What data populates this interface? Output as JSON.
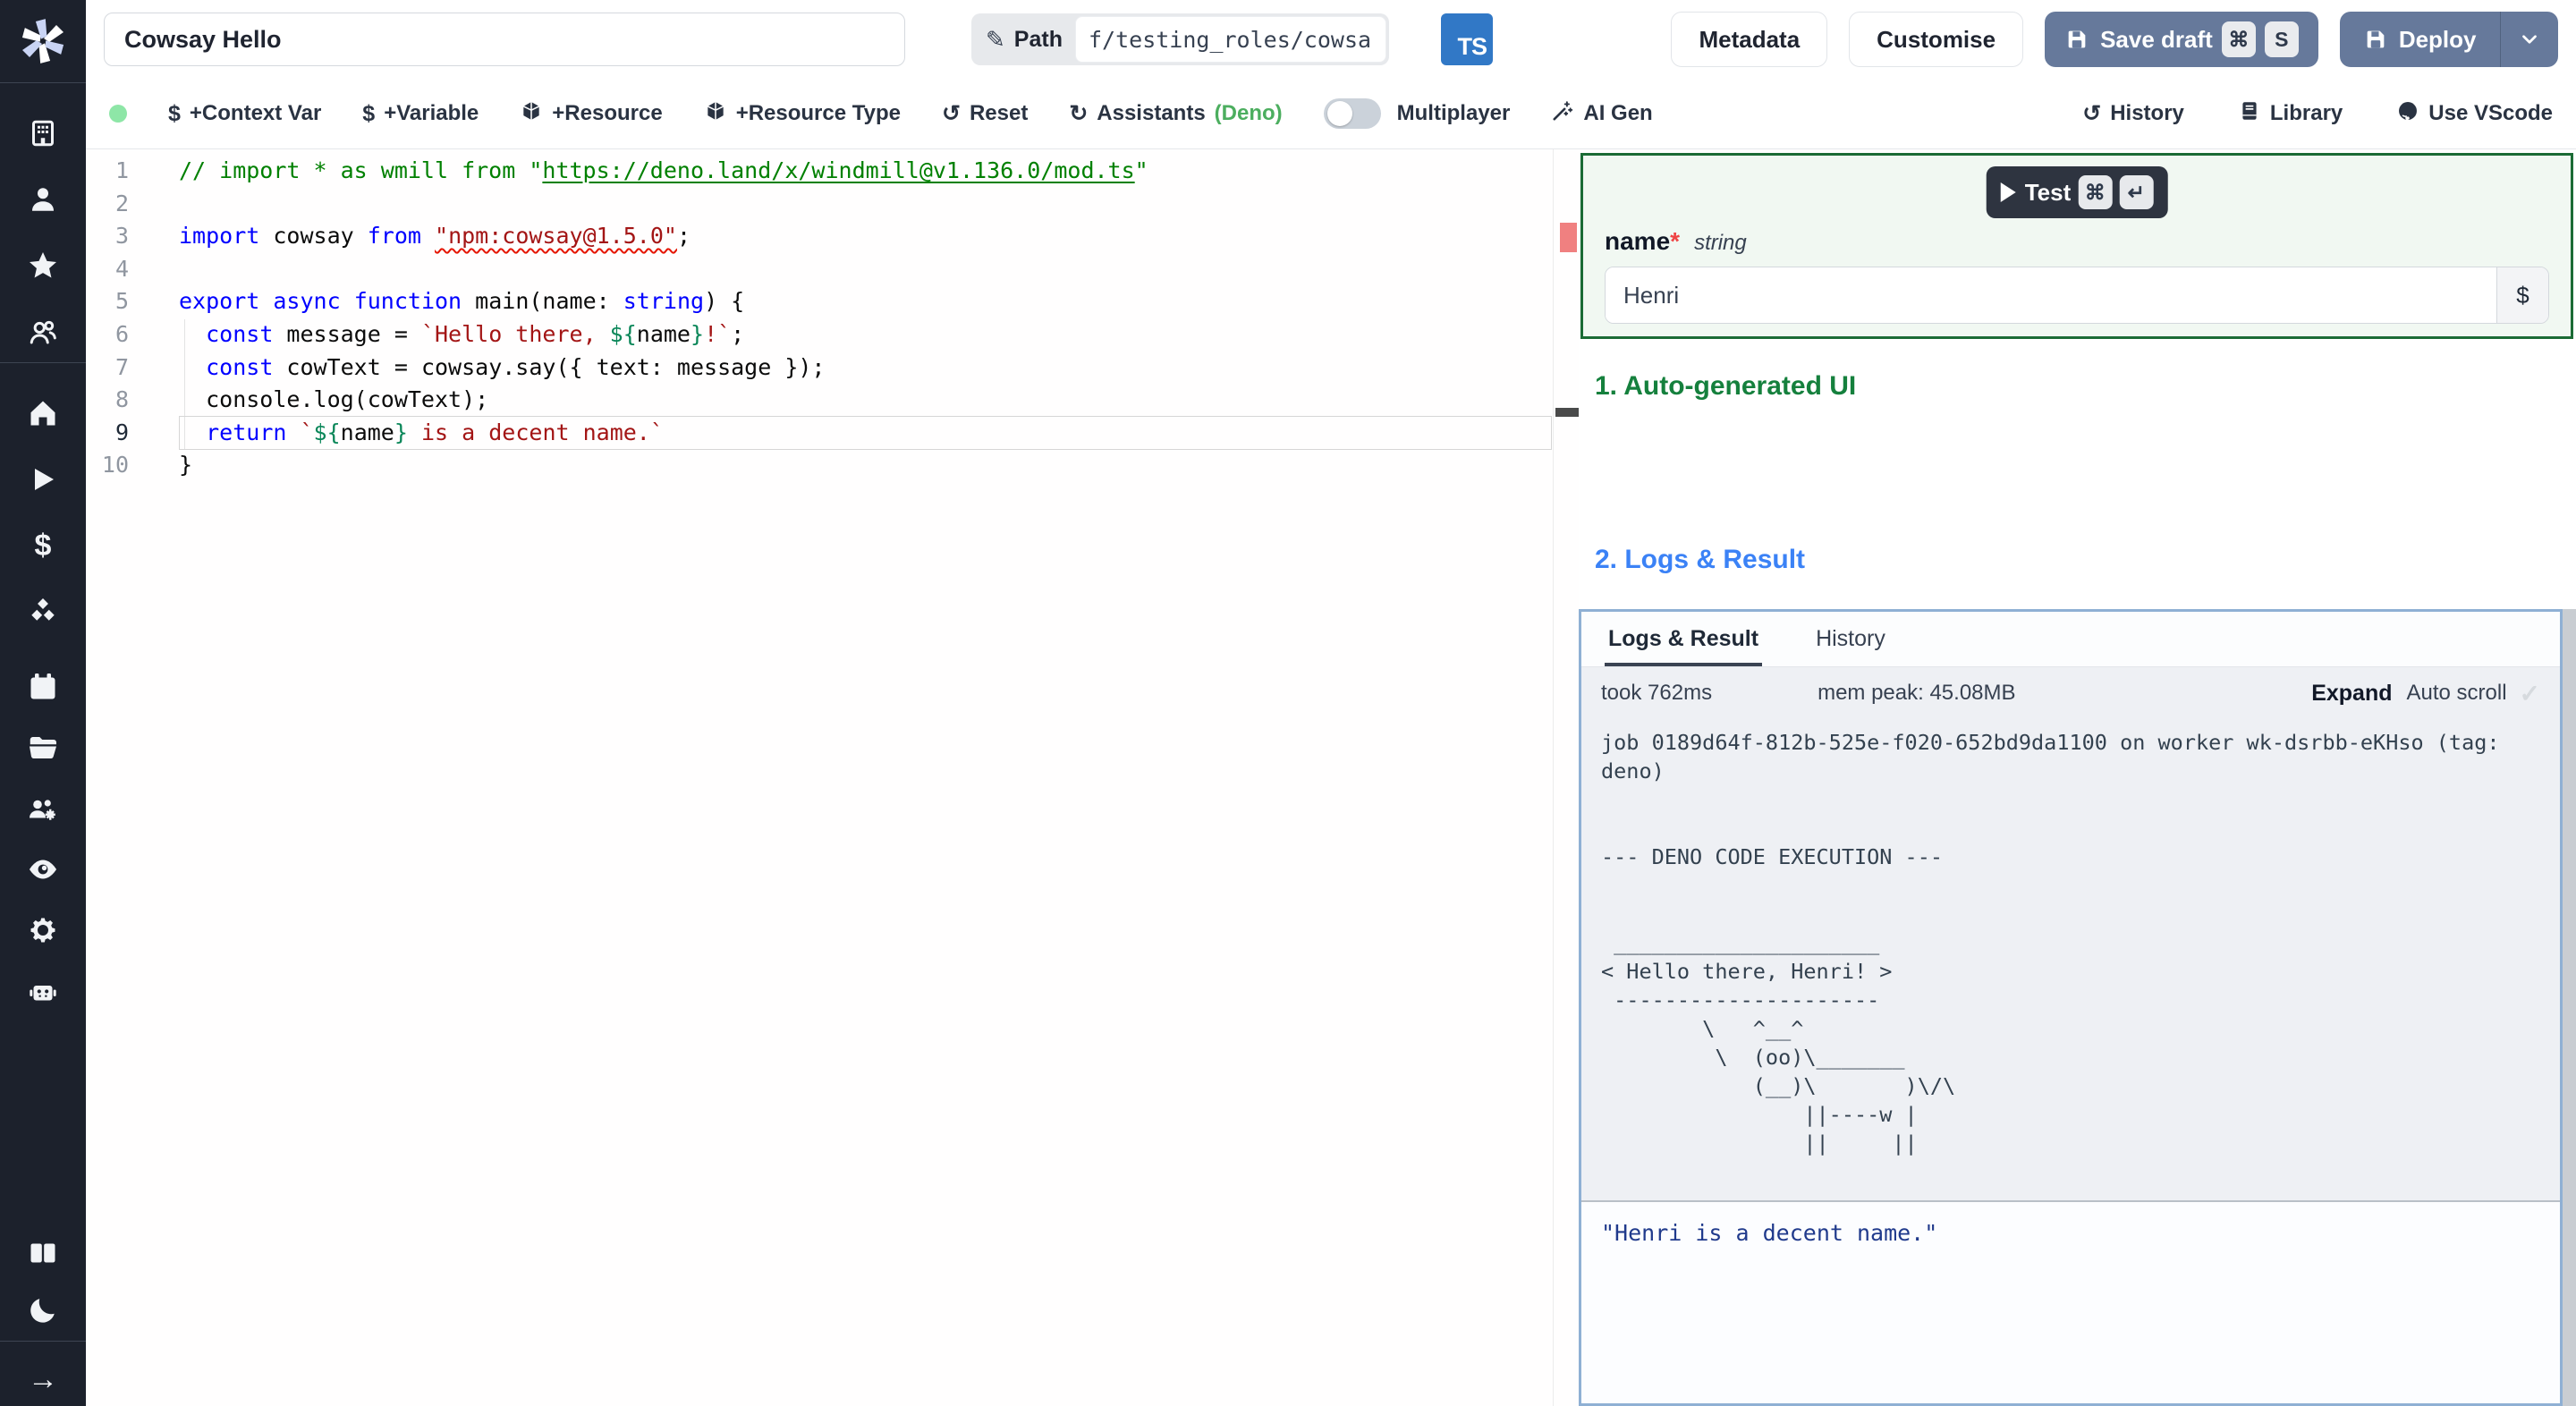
{
  "sidebar": {
    "logo": "windmill-logo",
    "groups": {
      "workspace": [
        "building-icon",
        "person-icon",
        "star-icon",
        "users-icon"
      ],
      "primary": [
        "home-icon",
        "play-icon",
        "dollar-icon",
        "cubes-icon"
      ],
      "secondary": [
        "calendar-icon",
        "folder-icon",
        "user-group-gear-icon",
        "eye-icon",
        "gear-icon",
        "robot-icon"
      ],
      "footer": [
        "book-icon",
        "moon-icon"
      ],
      "collapse": [
        "arrow-right-icon"
      ]
    }
  },
  "topbar": {
    "title_value": "Cowsay Hello",
    "path_label": "Path",
    "path_icon": "pencil-icon",
    "path_value": "f/testing_roles/cowsa",
    "lang_badge": "TS",
    "metadata_label": "Metadata",
    "customise_label": "Customise",
    "save_draft_label": "Save draft",
    "save_draft_kbd_1": "⌘",
    "save_draft_kbd_2": "S",
    "deploy_label": "Deploy",
    "button_color": "#66799b"
  },
  "toolbar": {
    "status_dot_color": "#8ee6a7",
    "context_var_label": "+Context Var",
    "variable_label": "+Variable",
    "resource_label": "+Resource",
    "resource_type_label": "+Resource Type",
    "reset_label": "Reset",
    "assistants_label": "Assistants ",
    "assistants_suffix": "(Deno)",
    "deno_color": "#4cae5f",
    "multiplayer_label": "Multiplayer",
    "ai_gen_label": "AI Gen",
    "history_label": "History",
    "library_label": "Library",
    "vscode_label": "Use VScode"
  },
  "editor": {
    "language": "typescript",
    "token_colors": {
      "keyword": "#0000ff",
      "string": "#a31515",
      "comment": "#008000",
      "template_delim": "#098658",
      "error_underline": "#e51400"
    },
    "lines": [
      {
        "n": 1,
        "seg": [
          [
            "c",
            "// import * as wmill from \""
          ],
          [
            "cl",
            "https://deno.land/x/windmill@v1.136.0/mod.ts"
          ],
          [
            "c",
            "\""
          ]
        ]
      },
      {
        "n": 2,
        "seg": []
      },
      {
        "n": 3,
        "seg": [
          [
            "k",
            "import"
          ],
          [
            "d",
            " cowsay "
          ],
          [
            "k",
            "from"
          ],
          [
            "d",
            " "
          ],
          [
            "se",
            "\"npm:cowsay@1.5.0\""
          ],
          [
            "d",
            ";"
          ]
        ]
      },
      {
        "n": 4,
        "seg": []
      },
      {
        "n": 5,
        "seg": [
          [
            "k",
            "export"
          ],
          [
            "d",
            " "
          ],
          [
            "k",
            "async"
          ],
          [
            "d",
            " "
          ],
          [
            "k",
            "function"
          ],
          [
            "d",
            " main(name: "
          ],
          [
            "k",
            "string"
          ],
          [
            "d",
            ") {"
          ]
        ]
      },
      {
        "n": 6,
        "seg": [
          [
            "d",
            "  "
          ],
          [
            "k",
            "const"
          ],
          [
            "d",
            " message = "
          ],
          [
            "s",
            "`Hello there, "
          ],
          [
            "g",
            "${"
          ],
          [
            "d",
            "name"
          ],
          [
            "g",
            "}"
          ],
          [
            "s",
            "!`"
          ],
          [
            "d",
            ";"
          ]
        ]
      },
      {
        "n": 7,
        "seg": [
          [
            "d",
            "  "
          ],
          [
            "k",
            "const"
          ],
          [
            "d",
            " cowText = cowsay.say({ text: message });"
          ]
        ]
      },
      {
        "n": 8,
        "seg": [
          [
            "d",
            "  console.log(cowText);"
          ]
        ]
      },
      {
        "n": 9,
        "current": true,
        "seg": [
          [
            "d",
            "  "
          ],
          [
            "k",
            "return"
          ],
          [
            "d",
            " "
          ],
          [
            "s",
            "`"
          ],
          [
            "g",
            "${"
          ],
          [
            "d",
            "name"
          ],
          [
            "g",
            "}"
          ],
          [
            "s",
            " is a decent name.`"
          ]
        ]
      },
      {
        "n": 10,
        "seg": [
          [
            "d",
            "}"
          ]
        ]
      }
    ]
  },
  "panel": {
    "test_label": "Test",
    "test_kbd_1": "⌘",
    "test_kbd_2": "↵",
    "field_name": "name",
    "field_required_mark": "*",
    "field_type": "string",
    "field_value": "Henri",
    "field_dollar_button": "$",
    "section1_title": "1. Auto-generated UI",
    "section1_color": "#15803d",
    "section2_title": "2. Logs & Result",
    "section2_color": "#3b82f6",
    "tab_logs_label": "Logs & Result",
    "tab_history_label": "History",
    "active_tab": "Logs & Result",
    "took_label": "took 762ms",
    "mem_label": "mem peak: 45.08MB",
    "expand_label": "Expand",
    "autoscroll_label": "Auto scroll",
    "autoscroll_checked": true,
    "log_lines": [
      "job 0189d64f-812b-525e-f020-652bd9da1100 on worker wk-dsrbb-eKHso (tag:",
      "deno)",
      "",
      "",
      "--- DENO CODE EXECUTION ---",
      "",
      "",
      " _____________________",
      "< Hello there, Henri! >",
      " ---------------------",
      "        \\   ^__^",
      "         \\  (oo)\\_______",
      "            (__)\\       )\\/\\",
      "                ||----w |",
      "                ||     ||"
    ],
    "result_value": "\"Henri is a decent name.\""
  }
}
